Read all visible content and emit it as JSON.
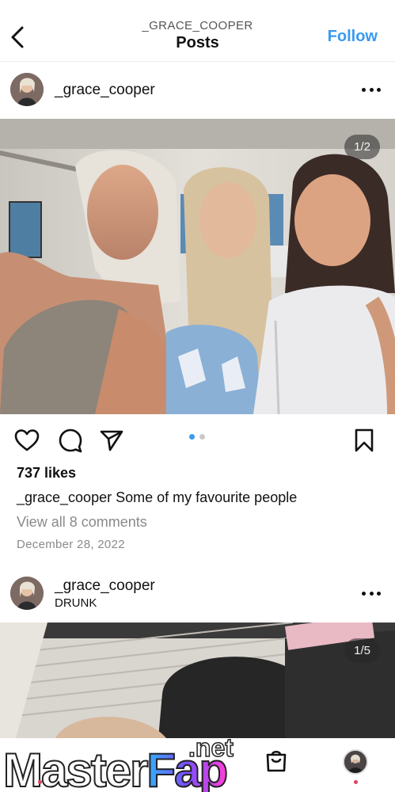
{
  "header": {
    "username": "_GRACE_COOPER",
    "title": "Posts",
    "follow_label": "Follow"
  },
  "post1": {
    "username": "_grace_cooper",
    "counter": "1/2",
    "likes": "737 likes",
    "caption_user": "_grace_cooper",
    "caption_text": "Some of my favourite people",
    "comments": "View all 8 comments",
    "date": "December 28, 2022",
    "carousel": {
      "count": 2,
      "active": 1
    }
  },
  "post2": {
    "username": "_grace_cooper",
    "subtitle": "DRUNK",
    "counter": "1/5"
  },
  "watermark": {
    "text_a": "Master",
    "text_b": "Fap",
    "suffix": ".net"
  },
  "colors": {
    "accent": "#3a9af0",
    "notification": "#e0435b",
    "carousel_active": "#3a9af0",
    "carousel_inactive": "#c9c9c9"
  },
  "icons": [
    "back-arrow-icon",
    "more-icon",
    "heart-icon",
    "comment-icon",
    "share-icon",
    "bookmark-icon",
    "shop-bag-icon"
  ]
}
